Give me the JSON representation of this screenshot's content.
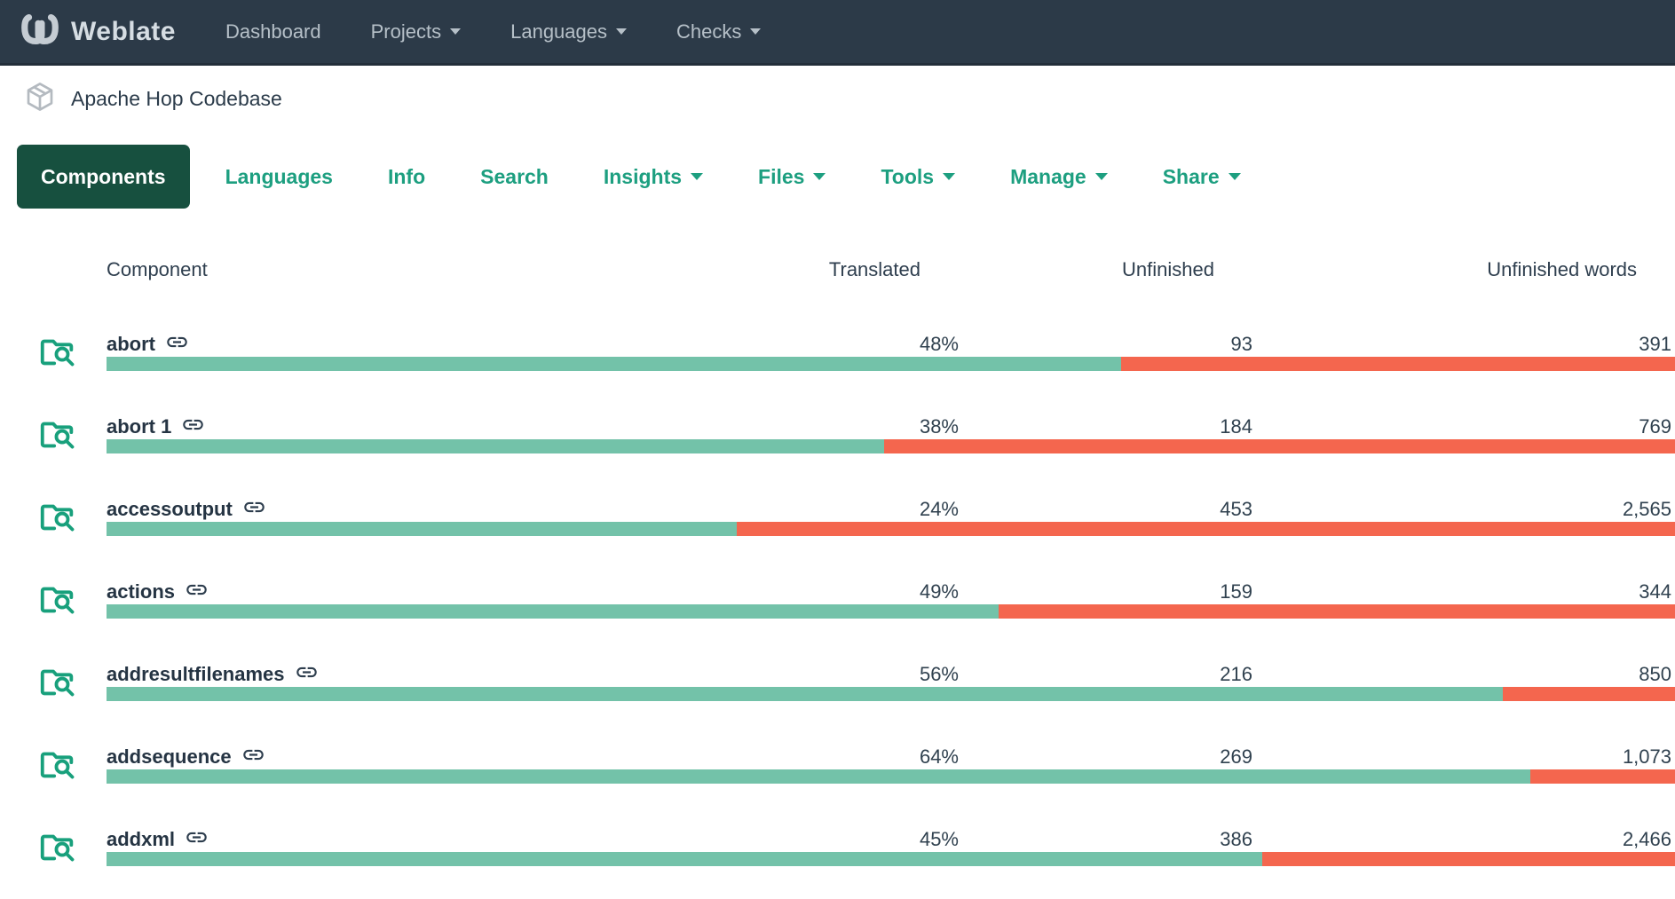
{
  "navbar": {
    "brand": "Weblate",
    "items": [
      {
        "label": "Dashboard",
        "caret": false
      },
      {
        "label": "Projects",
        "caret": true
      },
      {
        "label": "Languages",
        "caret": true
      },
      {
        "label": "Checks",
        "caret": true
      }
    ]
  },
  "breadcrumb": {
    "project": "Apache Hop Codebase"
  },
  "tabs": {
    "active": "Components",
    "items": [
      {
        "label": "Languages",
        "caret": false
      },
      {
        "label": "Info",
        "caret": false
      },
      {
        "label": "Search",
        "caret": false
      },
      {
        "label": "Insights",
        "caret": true
      },
      {
        "label": "Files",
        "caret": true
      },
      {
        "label": "Tools",
        "caret": true
      },
      {
        "label": "Manage",
        "caret": true
      },
      {
        "label": "Share",
        "caret": true
      }
    ]
  },
  "table": {
    "headers": {
      "component": "Component",
      "translated": "Translated",
      "unfinished": "Unfinished",
      "unfinished_words": "Unfinished words"
    },
    "rows": [
      {
        "name": "abort",
        "translated": "48%",
        "unfinished": "93",
        "unfinished_words": "391",
        "bar_green_pct": 64.7
      },
      {
        "name": "abort 1",
        "translated": "38%",
        "unfinished": "184",
        "unfinished_words": "769",
        "bar_green_pct": 49.6
      },
      {
        "name": "accessoutput",
        "translated": "24%",
        "unfinished": "453",
        "unfinished_words": "2,565",
        "bar_green_pct": 40.2
      },
      {
        "name": "actions",
        "translated": "49%",
        "unfinished": "159",
        "unfinished_words": "344",
        "bar_green_pct": 56.9
      },
      {
        "name": "addresultfilenames",
        "translated": "56%",
        "unfinished": "216",
        "unfinished_words": "850",
        "bar_green_pct": 89.0
      },
      {
        "name": "addsequence",
        "translated": "64%",
        "unfinished": "269",
        "unfinished_words": "1,073",
        "bar_green_pct": 90.8
      },
      {
        "name": "addxml",
        "translated": "45%",
        "unfinished": "386",
        "unfinished_words": "2,466",
        "bar_green_pct": 73.7
      }
    ]
  },
  "colors": {
    "navbar_bg": "#2c3a48",
    "navbar_border": "#232e3a",
    "accent_teal": "#1d9f80",
    "active_tab_bg": "#17503f",
    "bar_green": "#73c2a9",
    "bar_red": "#f4664e",
    "text_dark": "#2e3e4e"
  }
}
